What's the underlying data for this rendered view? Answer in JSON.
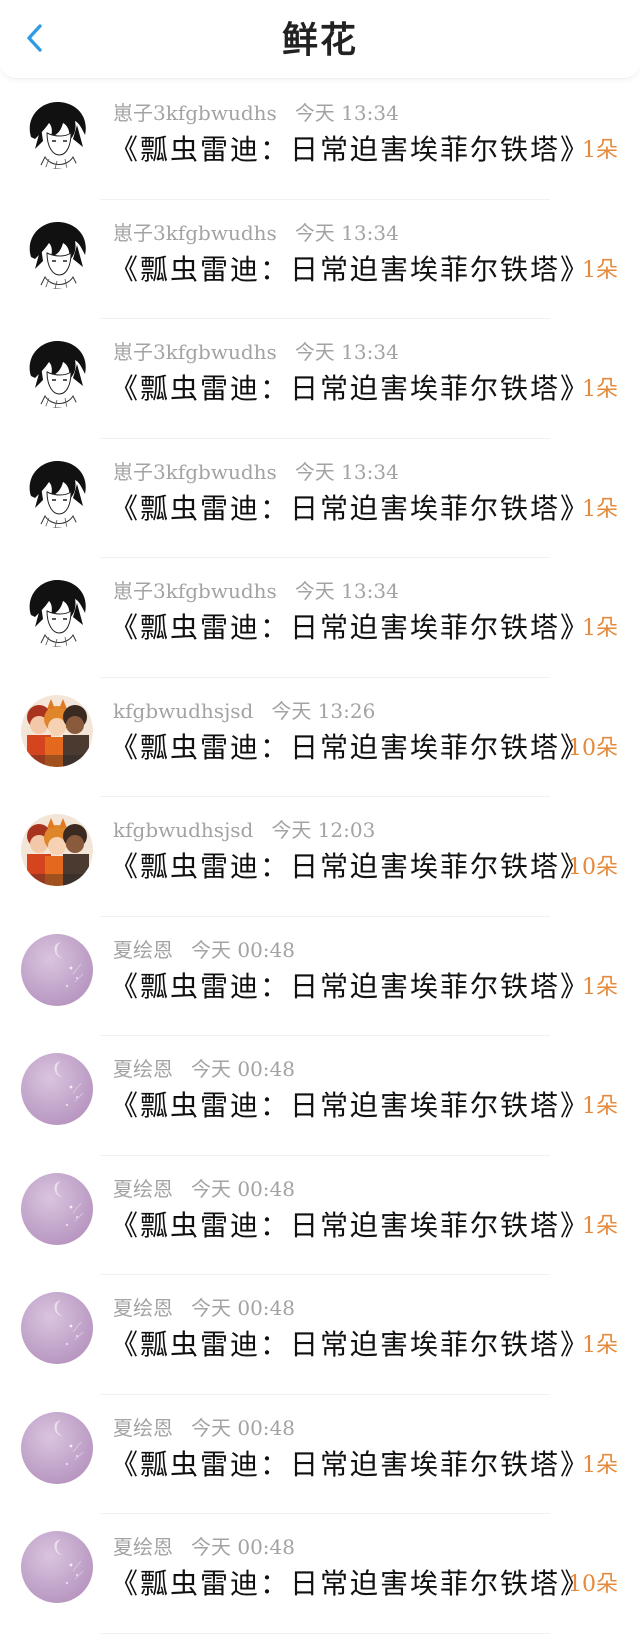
{
  "header": {
    "title": "鲜花",
    "back_icon": "chevron-left-icon",
    "accent_color": "#2f9be6"
  },
  "colors": {
    "count": "#e58a3c",
    "meta": "#a3a3a3"
  },
  "rows": [
    {
      "user": "崽子3kfgbwudhs",
      "time": "今天 13:34",
      "book": "《瓢虫雷迪：日常迫害埃菲尔铁塔》",
      "count": "1朵",
      "avatar": "anime-sketch-avatar"
    },
    {
      "user": "崽子3kfgbwudhs",
      "time": "今天 13:34",
      "book": "《瓢虫雷迪：日常迫害埃菲尔铁塔》",
      "count": "1朵",
      "avatar": "anime-sketch-avatar"
    },
    {
      "user": "崽子3kfgbwudhs",
      "time": "今天 13:34",
      "book": "《瓢虫雷迪：日常迫害埃菲尔铁塔》",
      "count": "1朵",
      "avatar": "anime-sketch-avatar"
    },
    {
      "user": "崽子3kfgbwudhs",
      "time": "今天 13:34",
      "book": "《瓢虫雷迪：日常迫害埃菲尔铁塔》",
      "count": "1朵",
      "avatar": "anime-sketch-avatar"
    },
    {
      "user": "崽子3kfgbwudhs",
      "time": "今天 13:34",
      "book": "《瓢虫雷迪：日常迫害埃菲尔铁塔》",
      "count": "1朵",
      "avatar": "anime-sketch-avatar"
    },
    {
      "user": "kfgbwudhsjsd",
      "time": "今天 13:26",
      "book": "《瓢虫雷迪：日常迫害埃菲尔铁塔》",
      "count": "10朵",
      "avatar": "cartoon-group-avatar"
    },
    {
      "user": "kfgbwudhsjsd",
      "time": "今天 12:03",
      "book": "《瓢虫雷迪：日常迫害埃菲尔铁塔》",
      "count": "10朵",
      "avatar": "cartoon-group-avatar"
    },
    {
      "user": "夏绘恩",
      "time": "今天 00:48",
      "book": "《瓢虫雷迪：日常迫害埃菲尔铁塔》",
      "count": "1朵",
      "avatar": "lilac-moon-avatar"
    },
    {
      "user": "夏绘恩",
      "time": "今天 00:48",
      "book": "《瓢虫雷迪：日常迫害埃菲尔铁塔》",
      "count": "1朵",
      "avatar": "lilac-moon-avatar"
    },
    {
      "user": "夏绘恩",
      "time": "今天 00:48",
      "book": "《瓢虫雷迪：日常迫害埃菲尔铁塔》",
      "count": "1朵",
      "avatar": "lilac-moon-avatar"
    },
    {
      "user": "夏绘恩",
      "time": "今天 00:48",
      "book": "《瓢虫雷迪：日常迫害埃菲尔铁塔》",
      "count": "1朵",
      "avatar": "lilac-moon-avatar"
    },
    {
      "user": "夏绘恩",
      "time": "今天 00:48",
      "book": "《瓢虫雷迪：日常迫害埃菲尔铁塔》",
      "count": "1朵",
      "avatar": "lilac-moon-avatar"
    },
    {
      "user": "夏绘恩",
      "time": "今天 00:48",
      "book": "《瓢虫雷迪：日常迫害埃菲尔铁塔》",
      "count": "10朵",
      "avatar": "lilac-moon-avatar"
    }
  ]
}
